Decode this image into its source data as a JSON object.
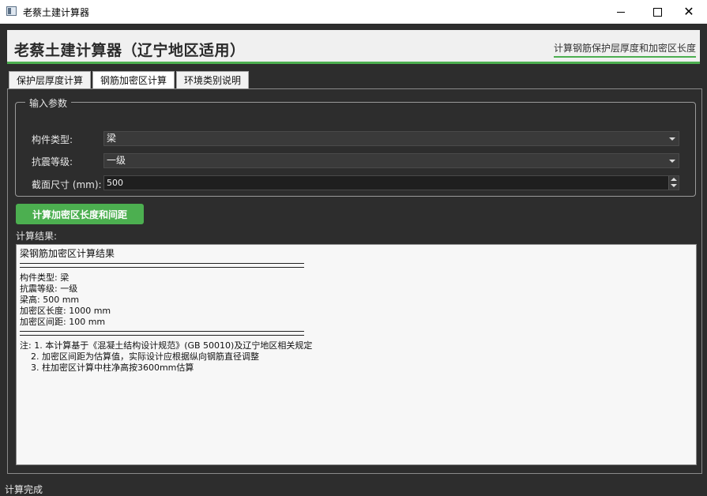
{
  "window": {
    "title": "老蔡土建计算器",
    "minimize_glyph": "—",
    "maximize_glyph": "□",
    "close_glyph": "✕"
  },
  "header": {
    "title": "老蔡土建计算器（辽宁地区适用）",
    "subtitle": "计算钢筋保护层厚度和加密区长度",
    "accent_color": "#4caf50"
  },
  "tabs": [
    {
      "label": "保护层厚度计算",
      "active": false
    },
    {
      "label": "钢筋加密区计算",
      "active": true
    },
    {
      "label": "环境类别说明",
      "active": false
    }
  ],
  "input_group": {
    "title": "输入参数",
    "fields": [
      {
        "label": "构件类型:",
        "value": "梁"
      },
      {
        "label": "抗震等级:",
        "value": "一级"
      },
      {
        "label": "截面尺寸 (mm):",
        "value": "500"
      }
    ]
  },
  "calculate_button": {
    "label": "计算加密区长度和间距",
    "color": "#4caf50"
  },
  "results": {
    "label": "计算结果:",
    "title": "梁钢筋加密区计算结果",
    "details": [
      "构件类型: 梁",
      "抗震等级: 一级",
      "梁高: 500 mm",
      "加密区长度: 1000 mm",
      "加密区间距: 100 mm"
    ],
    "notes": [
      "注: 1. 本计算基于《混凝土结构设计规范》(GB 50010)及辽宁地区相关规定",
      "    2. 加密区间距为估算值，实际设计应根据纵向钢筋直径调整",
      "    3. 柱加密区计算中柱净高按3600mm估算"
    ]
  },
  "status": {
    "text": "计算完成"
  }
}
